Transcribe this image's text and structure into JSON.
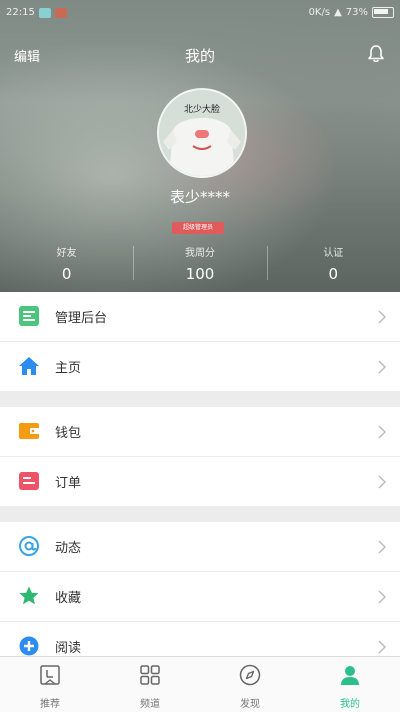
{
  "status_bar": {
    "time": "22:15",
    "network_speed": "0K/s",
    "battery_percent": "73%"
  },
  "nav": {
    "edit_label": "编辑",
    "title": "我的"
  },
  "profile": {
    "username": "表少****",
    "badge_text": "超级管理员",
    "avatar_caption": "北少大脸"
  },
  "stats": [
    {
      "label": "好友",
      "value": "0"
    },
    {
      "label": "我周分",
      "value": "100"
    },
    {
      "label": "认证",
      "value": "0"
    }
  ],
  "menu_groups": [
    [
      {
        "label": "管理后台",
        "icon": "admin-icon",
        "color": "#4cc47c"
      },
      {
        "label": "主页",
        "icon": "home-icon",
        "color": "#2d8cf0"
      }
    ],
    [
      {
        "label": "钱包",
        "icon": "wallet-icon",
        "color": "#f39c12"
      },
      {
        "label": "订单",
        "icon": "order-icon",
        "color": "#ef5466"
      }
    ],
    [
      {
        "label": "动态",
        "icon": "at-icon",
        "color": "#3aa3e3"
      },
      {
        "label": "收藏",
        "icon": "star-icon",
        "color": "#2eb872"
      },
      {
        "label": "阅读",
        "icon": "read-icon",
        "color": "#2d8cf0"
      }
    ]
  ],
  "tabs": [
    {
      "label": "推荐",
      "icon": "recommend-icon",
      "active": false
    },
    {
      "label": "频道",
      "icon": "channel-grid-icon",
      "active": false
    },
    {
      "label": "发现",
      "icon": "compass-icon",
      "active": false
    },
    {
      "label": "我的",
      "icon": "person-icon",
      "active": true
    }
  ],
  "colors": {
    "accent": "#2bbf8a",
    "badge": "#e05b5b"
  }
}
